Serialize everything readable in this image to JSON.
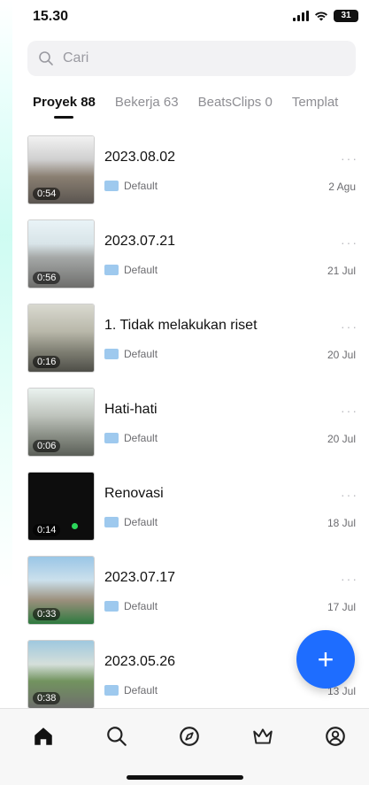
{
  "status": {
    "time": "15.30",
    "battery": "31"
  },
  "search": {
    "placeholder": "Cari"
  },
  "tabs": [
    {
      "label": "Proyek 88",
      "active": true
    },
    {
      "label": "Bekerja 63",
      "active": false
    },
    {
      "label": "BeatsClips 0",
      "active": false
    },
    {
      "label": "Templat",
      "active": false
    }
  ],
  "projects": [
    {
      "title": "2023.08.02",
      "duration": "0:54",
      "folder": "Default",
      "date": "2 Agu"
    },
    {
      "title": "2023.07.21",
      "duration": "0:56",
      "folder": "Default",
      "date": "21 Jul"
    },
    {
      "title": "1. Tidak melakukan riset",
      "duration": "0:16",
      "folder": "Default",
      "date": "20 Jul"
    },
    {
      "title": "Hati-hati",
      "duration": "0:06",
      "folder": "Default",
      "date": "20 Jul"
    },
    {
      "title": "Renovasi",
      "duration": "0:14",
      "folder": "Default",
      "date": "18 Jul"
    },
    {
      "title": "2023.07.17",
      "duration": "0:33",
      "folder": "Default",
      "date": "17 Jul"
    },
    {
      "title": "2023.05.26",
      "duration": "0:38",
      "folder": "Default",
      "date": "13 Jul"
    }
  ],
  "fab": {
    "label": "+"
  },
  "nav": [
    {
      "icon": "home-icon"
    },
    {
      "icon": "search-icon"
    },
    {
      "icon": "compass-icon"
    },
    {
      "icon": "crown-icon"
    },
    {
      "icon": "profile-icon"
    }
  ],
  "colors": {
    "accent": "#1e6dff",
    "folder": "#9ec9ee"
  }
}
